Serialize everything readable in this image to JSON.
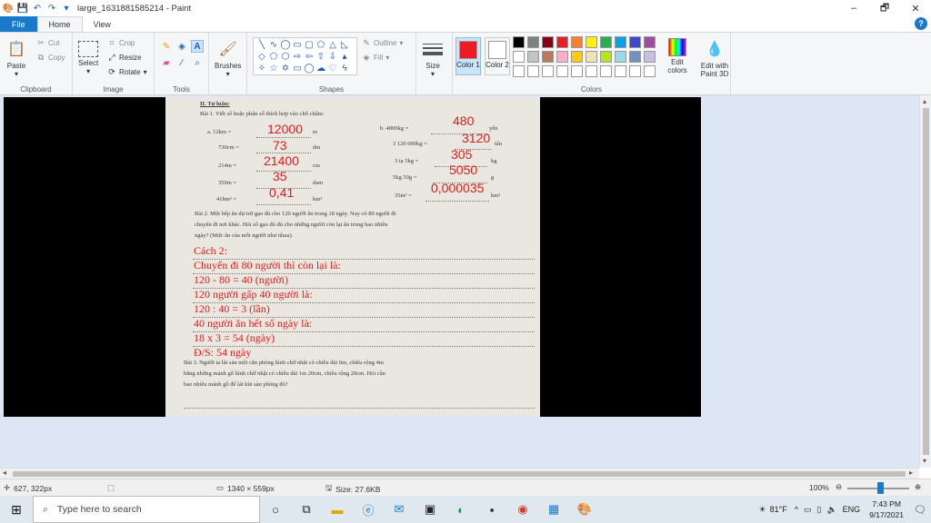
{
  "window": {
    "title": "large_1631881585214 - Paint",
    "controls": [
      "–",
      "🗗",
      "✕"
    ]
  },
  "tabs": [
    {
      "label": "File"
    },
    {
      "label": "Home"
    },
    {
      "label": "View"
    }
  ],
  "ribbon": {
    "clipboard": {
      "paste": "Paste",
      "cut": "Cut",
      "copy": "Copy",
      "label": "Clipboard"
    },
    "image": {
      "select": "Select",
      "crop": "Crop",
      "resize": "Resize",
      "rotate": "Rotate",
      "label": "Image"
    },
    "tools": {
      "label": "Tools"
    },
    "brushes": {
      "label": "Brushes"
    },
    "shapes": {
      "outline": "Outline",
      "fill": "Fill",
      "label": "Shapes"
    },
    "size": {
      "label": "Size"
    },
    "colors": {
      "color1": "Color 1",
      "color2": "Color 2",
      "color1_value": "#ed1c24",
      "color2_value": "#ffffff",
      "edit_colors": "Edit colors",
      "edit_paint3d": "Edit with Paint 3D",
      "label": "Colors",
      "palette": [
        "#000000",
        "#7f7f7f",
        "#880015",
        "#ed1c24",
        "#ff7f27",
        "#fff200",
        "#22b14c",
        "#00a2e8",
        "#3f48cc",
        "#a349a4",
        "#ffffff",
        "#c3c3c3",
        "#b97a57",
        "#ffaec9",
        "#ffc90e",
        "#efe4b0",
        "#b5e61d",
        "#99d9ea",
        "#7092be",
        "#c8bfe7",
        "#ffffff",
        "#ffffff",
        "#ffffff",
        "#ffffff",
        "#ffffff",
        "#ffffff",
        "#ffffff",
        "#ffffff",
        "#ffffff",
        "#ffffff"
      ]
    }
  },
  "document": {
    "heading": "II. Tự luận:",
    "bai1": "Bài 1. Viết số hoặc phân số thích hợp vào chỗ chấm:",
    "left_items": [
      {
        "q": "a. 12km =",
        "unit": "m",
        "ans": "12000"
      },
      {
        "q": "730cm =",
        "unit": "dm",
        "ans": "73"
      },
      {
        "q": "214m =",
        "unit": "cm",
        "ans": "21400"
      },
      {
        "q": "350m =",
        "unit": "dam",
        "ans": "35"
      },
      {
        "q": "41hm² =",
        "unit": "km²",
        "ans": "0,41"
      }
    ],
    "right_items": [
      {
        "q": "b. 4800kg =",
        "unit": "yến",
        "ans": "480"
      },
      {
        "q": "3 120 000kg =",
        "unit": "tấn",
        "ans": "3120"
      },
      {
        "q": "3 tạ 5kg =",
        "unit": "kg",
        "ans": "305"
      },
      {
        "q": "5kg 50g =",
        "unit": "g",
        "ans": "5050"
      },
      {
        "q": "35m² =",
        "unit": "km²",
        "ans": "0,000035"
      }
    ],
    "bai2_line1": "Bài 2. Một bếp ăn dự trữ gạo đủ cho 120 người ăn trong 18 ngày. Nay có 80 người đi",
    "bai2_line2": "chuyển đi nơi khác. Hỏi số gạo đó đủ cho những người còn lại ăn trong bao nhiêu",
    "bai2_line3": "ngày? (Mức ăn của mỗi người như nhau).",
    "solution": [
      "Cách 2:",
      "Chuyển đi 80 người thì còn lại là:",
      "120 - 80 = 40 (người)",
      "120 người gấp 40 người là:",
      "120 : 40 = 3 (lần)",
      "40 người ăn hết số ngày là:",
      "18 x 3 = 54 (ngày)",
      "Đ/S: 54 ngày"
    ],
    "bai3_line1": "Bài 3. Người ta lát sàn một căn phòng hình chữ nhật có chiều dài 6m, chiều rộng 4m",
    "bai3_line2": "bằng những mảnh gỗ hình chữ nhật có chiều dài 1m 20cm, chiều rộng 20cm. Hỏi cần",
    "bai3_line3": "bao nhiêu mảnh gỗ để lát kín sàn phòng đó?"
  },
  "status": {
    "cursor": "627, 322px",
    "dimensions": "1340 × 559px",
    "size": "Size: 27.6KB",
    "zoom": "100%"
  },
  "taskbar": {
    "search_placeholder": "Type here to search",
    "weather": "81°F",
    "lang": "ENG",
    "time": "7:43 PM",
    "date": "9/17/2021"
  }
}
